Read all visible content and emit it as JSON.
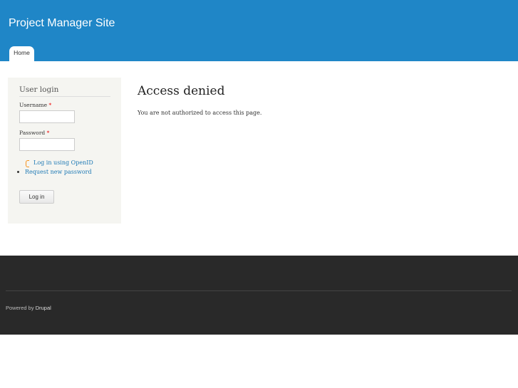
{
  "header": {
    "site_name": "Project Manager Site",
    "tabs": [
      {
        "label": "Home"
      }
    ]
  },
  "sidebar": {
    "title": "User login",
    "username_label": "Username",
    "password_label": "Password",
    "required": "*",
    "username_value": "",
    "password_value": "",
    "openid_link": "Log in using OpenID",
    "request_password_link": "Request new password",
    "login_button": "Log in"
  },
  "main": {
    "title": "Access denied",
    "message": "You are not authorized to access this page."
  },
  "footer": {
    "powered_by": "Powered by",
    "drupal_link": "Drupal"
  }
}
